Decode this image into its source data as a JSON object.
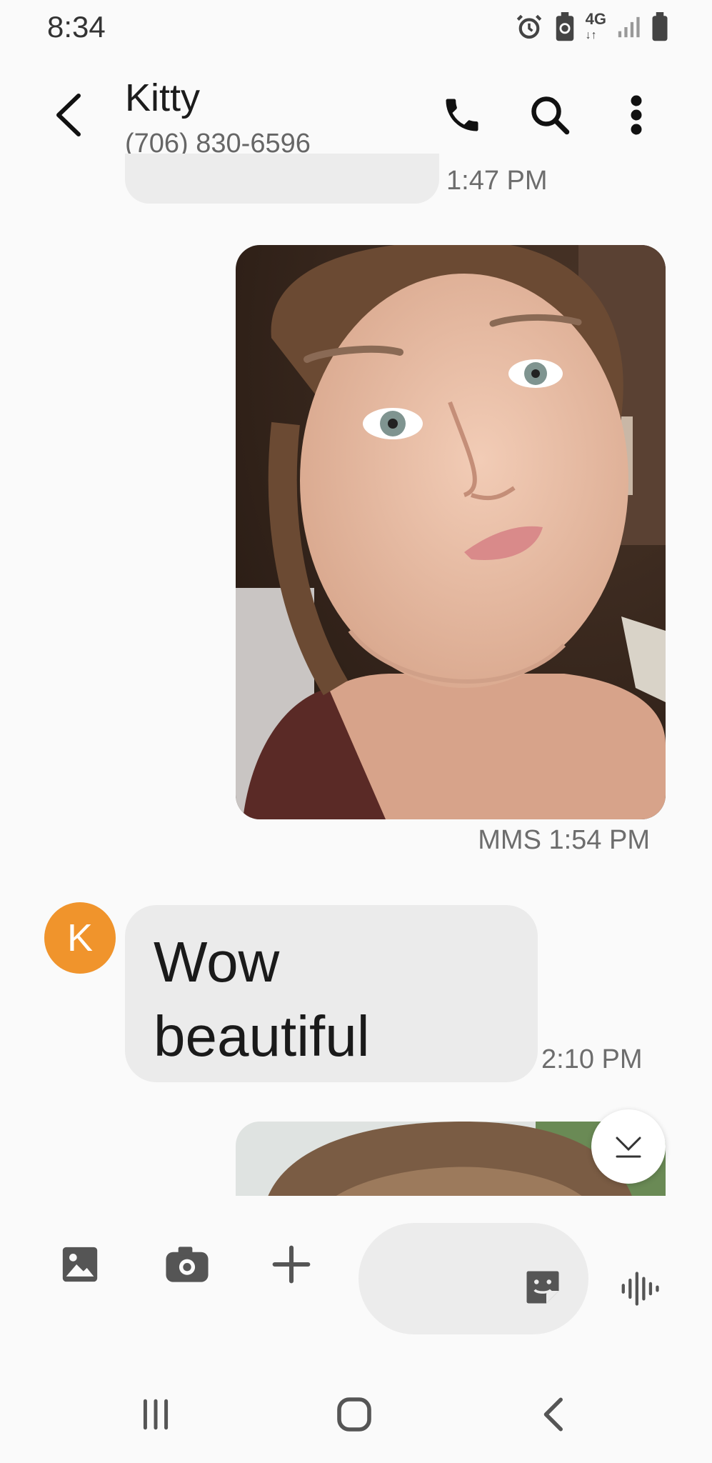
{
  "status_bar": {
    "time": "8:34",
    "network": "4G",
    "icons": [
      "alarm-icon",
      "battery-saver-icon",
      "4g-icon",
      "signal-icon",
      "battery-icon"
    ]
  },
  "header": {
    "contact_name": "Kitty",
    "contact_number": "(706) 830-6596",
    "icons": [
      "back-arrow-icon",
      "phone-icon",
      "search-icon",
      "more-vert-icon"
    ]
  },
  "conversation": {
    "previous_message_time": "1:47 PM",
    "photo_message": {
      "type_label": "MMS 1:54 PM"
    },
    "received_message": {
      "avatar_letter": "K",
      "line1": "Wow",
      "line2": "beautiful",
      "time": "2:10 PM"
    }
  },
  "composer": {
    "placeholder": "",
    "icons": [
      "gallery-icon",
      "camera-icon",
      "plus-icon",
      "sticker-icon",
      "voice-icon"
    ]
  },
  "nav_bar": {
    "icons": [
      "recents-icon",
      "home-icon",
      "nav-back-icon"
    ]
  },
  "colors": {
    "avatar": "#f0942c",
    "bubble": "#ebebeb",
    "background": "#fafafa"
  }
}
